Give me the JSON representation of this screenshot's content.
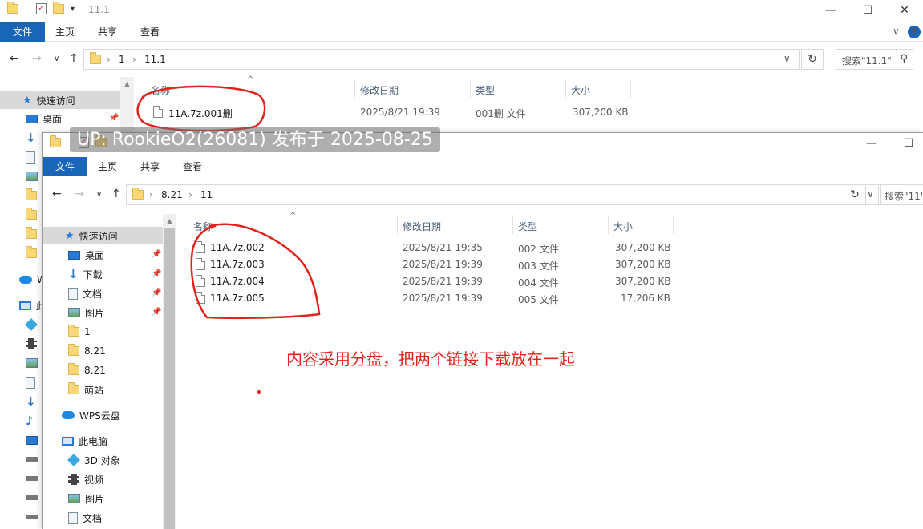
{
  "win1": {
    "title": "11.1",
    "ribbon": {
      "file": "文件",
      "home": "主页",
      "share": "共享",
      "view": "查看"
    },
    "address": [
      "1",
      "11.1"
    ],
    "search_placeholder": "搜索\"11.1\"",
    "sidebar": [
      {
        "label": "快速访问",
        "icon": "star-icon"
      },
      {
        "label": "桌面",
        "icon": "desktop-icon"
      }
    ],
    "columns": {
      "name": "名称",
      "date": "修改日期",
      "type": "类型",
      "size": "大小"
    },
    "files": [
      {
        "name": "11A.7z.001删",
        "date": "2025/8/21 19:39",
        "type": "001删 文件",
        "size": "307,200 KB"
      }
    ],
    "sidebar_cut": [
      "W",
      "此"
    ]
  },
  "win2": {
    "ribbon": {
      "file": "文件",
      "home": "主页",
      "share": "共享",
      "view": "查看"
    },
    "address": [
      "8.21",
      "11"
    ],
    "search_placeholder": "搜索\"11\"",
    "sidebar": [
      {
        "label": "快速访问",
        "icon": "star-icon",
        "selected": true
      },
      {
        "label": "桌面",
        "icon": "desktop-icon",
        "pinned": true
      },
      {
        "label": "下载",
        "icon": "download-icon",
        "pinned": true
      },
      {
        "label": "文档",
        "icon": "document-icon",
        "pinned": true
      },
      {
        "label": "图片",
        "icon": "pictures-icon",
        "pinned": true
      },
      {
        "label": "1",
        "icon": "folder-icon"
      },
      {
        "label": "8.21",
        "icon": "folder-icon"
      },
      {
        "label": "8.21",
        "icon": "folder-icon"
      },
      {
        "label": "萌站",
        "icon": "folder-icon"
      },
      {
        "label": "WPS云盘",
        "icon": "cloud-icon"
      },
      {
        "label": "此电脑",
        "icon": "computer-icon"
      },
      {
        "label": "3D 对象",
        "icon": "3d-objects-icon"
      },
      {
        "label": "视频",
        "icon": "video-icon"
      },
      {
        "label": "图片",
        "icon": "pictures-icon"
      },
      {
        "label": "文档",
        "icon": "document-icon"
      }
    ],
    "columns": {
      "name": "名称",
      "date": "修改日期",
      "type": "类型",
      "size": "大小"
    },
    "files": [
      {
        "name": "11A.7z.002",
        "date": "2025/8/21 19:35",
        "type": "002 文件",
        "size": "307,200 KB"
      },
      {
        "name": "11A.7z.003",
        "date": "2025/8/21 19:39",
        "type": "003 文件",
        "size": "307,200 KB"
      },
      {
        "name": "11A.7z.004",
        "date": "2025/8/21 19:39",
        "type": "004 文件",
        "size": "307,200 KB"
      },
      {
        "name": "11A.7z.005",
        "date": "2025/8/21 19:39",
        "type": "005 文件",
        "size": "17,206 KB"
      }
    ]
  },
  "overlay": "UP: RookieO2(26081) 发布于 2025-08-25",
  "annotation_note": "内容采用分盘，把两个链接下载放在一起",
  "colors": {
    "ribbon_file_tab": "#1966b8",
    "annotation": "#e0241b",
    "selection": "#d9d9d9",
    "header_text": "#4c607a"
  }
}
